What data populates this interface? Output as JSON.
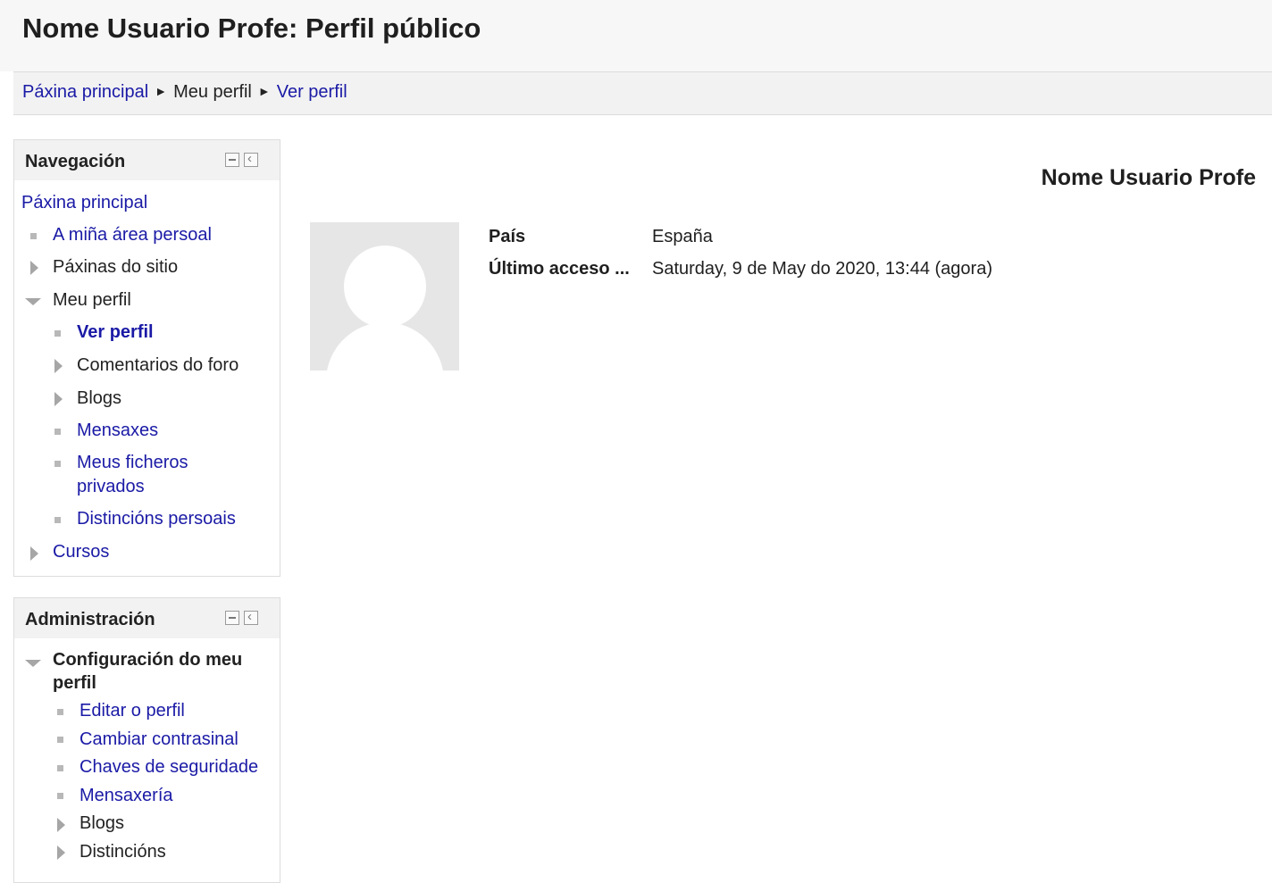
{
  "header": {
    "title": "Nome Usuario Profe: Perfil público"
  },
  "breadcrumb": {
    "items": [
      "Páxina principal",
      "Meu perfil",
      "Ver perfil"
    ],
    "separator": "►"
  },
  "navigation_block": {
    "title": "Navegación",
    "home": "Páxina principal",
    "items": {
      "dashboard": "A miña área persoal",
      "site_pages": "Páxinas do sitio",
      "my_profile": "Meu perfil",
      "view_profile": "Ver perfil",
      "forum_posts": "Comentarios do foro",
      "blogs": "Blogs",
      "messages": "Mensaxes",
      "private_files_line1": "Meus ficheros",
      "private_files_line2": "privados",
      "badges": "Distincións persoais",
      "courses": "Cursos"
    }
  },
  "administration_block": {
    "title": "Administración",
    "section_line1": "Configuración do meu",
    "section_line2": "perfil",
    "items": {
      "edit_profile": "Editar o perfil",
      "change_password": "Cambiar contrasinal",
      "security_keys": "Chaves de seguridade",
      "messaging": "Mensaxería",
      "blogs": "Blogs",
      "badges": "Distincións"
    }
  },
  "profile": {
    "name": "Nome Usuario Profe",
    "fields": [
      {
        "label": "País",
        "value": "España"
      },
      {
        "label": "Último acceso ...",
        "value": "Saturday, 9 de May do 2020, 13:44  (agora)"
      }
    ]
  },
  "colors": {
    "link": "#1a1aa6",
    "header_bg": "#f7f7f7",
    "navbar_bg": "#f2f2f2"
  },
  "icons": [
    "hide-block-icon",
    "dock-block-icon",
    "bullet-icon",
    "expand-arrow-icon",
    "collapse-arrow-icon",
    "default-avatar-icon"
  ]
}
